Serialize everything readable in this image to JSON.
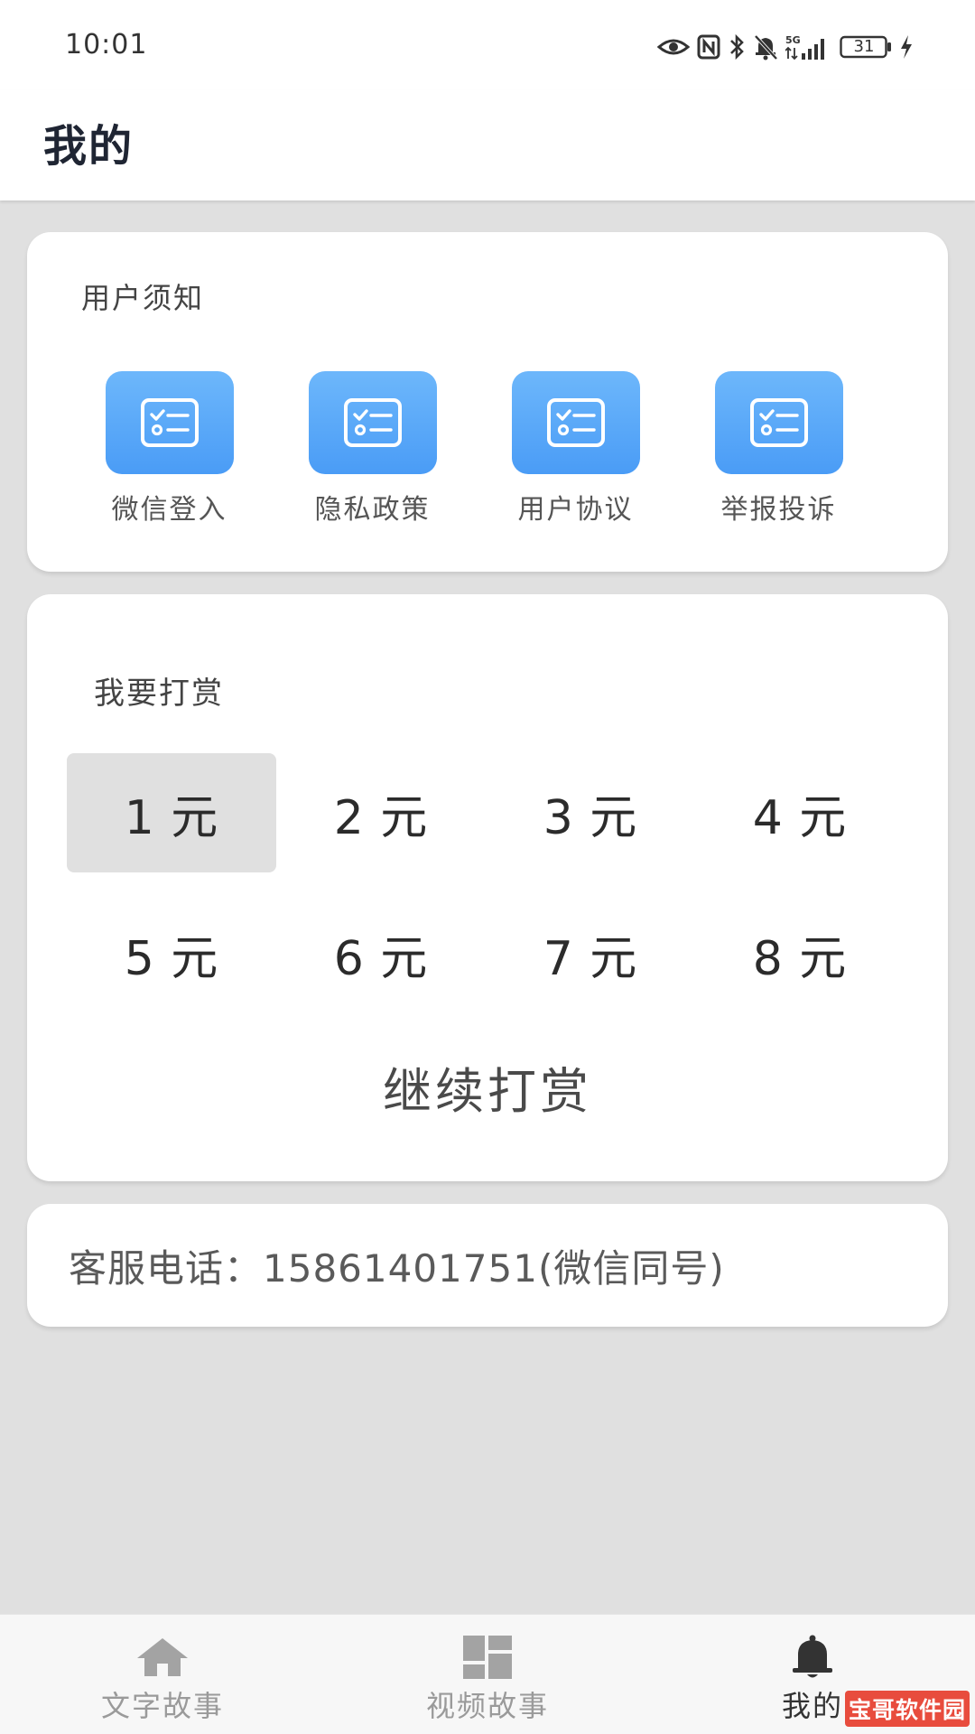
{
  "status_bar": {
    "time": "10:01",
    "network": "5G",
    "battery": "31",
    "icons": [
      "eye-icon",
      "nfc-icon",
      "bluetooth-icon",
      "mute-bell-icon",
      "signal-icon",
      "battery-icon",
      "charging-icon"
    ]
  },
  "header": {
    "title": "我的"
  },
  "notice": {
    "title": "用户须知",
    "items": [
      {
        "label": "微信登入",
        "icon": "checklist-card-icon"
      },
      {
        "label": "隐私政策",
        "icon": "checklist-card-icon"
      },
      {
        "label": "用户协议",
        "icon": "checklist-card-icon"
      },
      {
        "label": "举报投诉",
        "icon": "checklist-card-icon"
      }
    ],
    "icon_color": "#5aa8f8"
  },
  "reward": {
    "title": "我要打赏",
    "amounts": [
      "1 元",
      "2 元",
      "3 元",
      "4 元",
      "5 元",
      "6 元",
      "7 元",
      "8 元"
    ],
    "selected_index": 0,
    "continue_label": "继续打赏"
  },
  "service": {
    "text": "客服电话：15861401751(微信同号)"
  },
  "bottom_nav": {
    "items": [
      {
        "label": "文字故事",
        "icon": "home-icon"
      },
      {
        "label": "视频故事",
        "icon": "dashboard-grid-icon"
      },
      {
        "label": "我的",
        "icon": "bell-icon"
      }
    ],
    "active_index": 2
  },
  "watermark": {
    "text": "宝哥软件园"
  }
}
